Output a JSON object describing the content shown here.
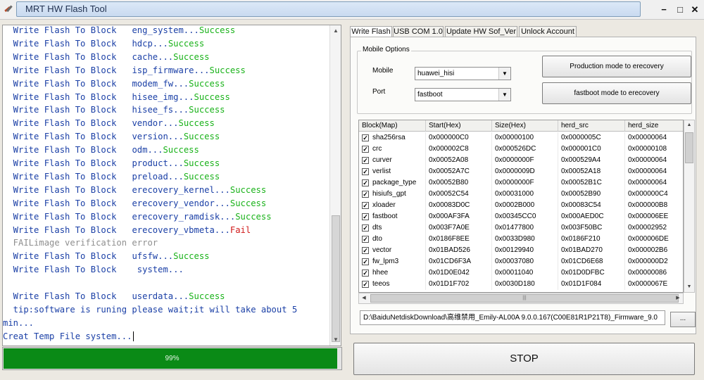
{
  "window": {
    "title": "MRT HW Flash Tool",
    "app_icon": "tool-icon",
    "controls": {
      "minimize": "−",
      "maximize": "□",
      "close": "✕"
    }
  },
  "log": {
    "lines": [
      {
        "parts": [
          {
            "text": "  Write Flash To Block   ",
            "color": "blue"
          },
          {
            "text": "eng_system...",
            "color": "blue"
          },
          {
            "text": "Success",
            "color": "green"
          }
        ]
      },
      {
        "parts": [
          {
            "text": "  Write Flash To Block   ",
            "color": "blue"
          },
          {
            "text": "hdcp...",
            "color": "blue"
          },
          {
            "text": "Success",
            "color": "green"
          }
        ]
      },
      {
        "parts": [
          {
            "text": "  Write Flash To Block   ",
            "color": "blue"
          },
          {
            "text": "cache...",
            "color": "blue"
          },
          {
            "text": "Success",
            "color": "green"
          }
        ]
      },
      {
        "parts": [
          {
            "text": "  Write Flash To Block   ",
            "color": "blue"
          },
          {
            "text": "isp_firmware...",
            "color": "blue"
          },
          {
            "text": "Success",
            "color": "green"
          }
        ]
      },
      {
        "parts": [
          {
            "text": "  Write Flash To Block   ",
            "color": "blue"
          },
          {
            "text": "modem_fw...",
            "color": "blue"
          },
          {
            "text": "Success",
            "color": "green"
          }
        ]
      },
      {
        "parts": [
          {
            "text": "  Write Flash To Block   ",
            "color": "blue"
          },
          {
            "text": "hisee_img...",
            "color": "blue"
          },
          {
            "text": "Success",
            "color": "green"
          }
        ]
      },
      {
        "parts": [
          {
            "text": "  Write Flash To Block   ",
            "color": "blue"
          },
          {
            "text": "hisee_fs...",
            "color": "blue"
          },
          {
            "text": "Success",
            "color": "green"
          }
        ]
      },
      {
        "parts": [
          {
            "text": "  Write Flash To Block   ",
            "color": "blue"
          },
          {
            "text": "vendor...",
            "color": "blue"
          },
          {
            "text": "Success",
            "color": "green"
          }
        ]
      },
      {
        "parts": [
          {
            "text": "  Write Flash To Block   ",
            "color": "blue"
          },
          {
            "text": "version...",
            "color": "blue"
          },
          {
            "text": "Success",
            "color": "green"
          }
        ]
      },
      {
        "parts": [
          {
            "text": "  Write Flash To Block   ",
            "color": "blue"
          },
          {
            "text": "odm...",
            "color": "blue"
          },
          {
            "text": "Success",
            "color": "green"
          }
        ]
      },
      {
        "parts": [
          {
            "text": "  Write Flash To Block   ",
            "color": "blue"
          },
          {
            "text": "product...",
            "color": "blue"
          },
          {
            "text": "Success",
            "color": "green"
          }
        ]
      },
      {
        "parts": [
          {
            "text": "  Write Flash To Block   ",
            "color": "blue"
          },
          {
            "text": "preload...",
            "color": "blue"
          },
          {
            "text": "Success",
            "color": "green"
          }
        ]
      },
      {
        "parts": [
          {
            "text": "  Write Flash To Block   ",
            "color": "blue"
          },
          {
            "text": "erecovery_kernel...",
            "color": "blue"
          },
          {
            "text": "Success",
            "color": "green"
          }
        ]
      },
      {
        "parts": [
          {
            "text": "  Write Flash To Block   ",
            "color": "blue"
          },
          {
            "text": "erecovery_vendor...",
            "color": "blue"
          },
          {
            "text": "Success",
            "color": "green"
          }
        ]
      },
      {
        "parts": [
          {
            "text": "  Write Flash To Block   ",
            "color": "blue"
          },
          {
            "text": "erecovery_ramdisk...",
            "color": "blue"
          },
          {
            "text": "Success",
            "color": "green"
          }
        ]
      },
      {
        "parts": [
          {
            "text": "  Write Flash To Block   ",
            "color": "blue"
          },
          {
            "text": "erecovery_vbmeta...",
            "color": "blue"
          },
          {
            "text": "Fail",
            "color": "red"
          }
        ]
      },
      {
        "parts": [
          {
            "text": "  FAILimage verification error",
            "color": "gray"
          }
        ]
      },
      {
        "parts": [
          {
            "text": "  Write Flash To Block   ",
            "color": "blue"
          },
          {
            "text": "ufsfw...",
            "color": "blue"
          },
          {
            "text": "Success",
            "color": "green"
          }
        ]
      },
      {
        "parts": [
          {
            "text": "  Write Flash To Block    ",
            "color": "blue"
          },
          {
            "text": "system...",
            "color": "blue"
          }
        ]
      },
      {
        "parts": [
          {
            "text": "",
            "color": "blue"
          }
        ]
      },
      {
        "parts": [
          {
            "text": "  Write Flash To Block   ",
            "color": "blue"
          },
          {
            "text": "userdata...",
            "color": "blue"
          },
          {
            "text": "Success",
            "color": "green"
          }
        ]
      },
      {
        "parts": [
          {
            "text": "  tip:software is runing please wait;it will take about 5",
            "color": "blue"
          }
        ]
      },
      {
        "parts": [
          {
            "text": "min...",
            "color": "blue"
          }
        ]
      },
      {
        "parts": [
          {
            "text": "Creat Temp File system...",
            "color": "blue"
          }
        ],
        "caret": true
      }
    ]
  },
  "progress": {
    "value": 0.99,
    "label": "99%",
    "fill_color": "#0a8a16"
  },
  "tabs": [
    {
      "label": "Write Flash",
      "active": true
    },
    {
      "label": "USB COM 1.0",
      "active": false
    },
    {
      "label": "Update HW Sof_Ver",
      "active": false
    },
    {
      "label": "Unlock Account",
      "active": false
    }
  ],
  "mobile_options": {
    "title": "Mobile Options",
    "mobile_label": "Mobile",
    "mobile_value": "huawei_hisi",
    "port_label": "Port",
    "port_value": "fastboot",
    "production_button": "Production mode to erecovery",
    "fastboot_button": "fastboot mode to erecovery"
  },
  "grid": {
    "columns": [
      "Block(Map)",
      "Start(Hex)",
      "Size(Hex)",
      "herd_src",
      "herd_size"
    ],
    "rows": [
      {
        "checked": true,
        "block": "sha256rsa",
        "start": "0x000000C0",
        "size": "0x00000100",
        "src": "0x0000005C",
        "hsize": "0x00000064"
      },
      {
        "checked": true,
        "block": "crc",
        "start": "0x000002C8",
        "size": "0x000526DC",
        "src": "0x000001C0",
        "hsize": "0x00000108"
      },
      {
        "checked": true,
        "block": "curver",
        "start": "0x00052A08",
        "size": "0x0000000F",
        "src": "0x000529A4",
        "hsize": "0x00000064"
      },
      {
        "checked": true,
        "block": "verlist",
        "start": "0x00052A7C",
        "size": "0x0000009D",
        "src": "0x00052A18",
        "hsize": "0x00000064"
      },
      {
        "checked": true,
        "block": "package_type",
        "start": "0x00052B80",
        "size": "0x0000000F",
        "src": "0x00052B1C",
        "hsize": "0x00000064"
      },
      {
        "checked": true,
        "block": "hisiufs_gpt",
        "start": "0x00052C54",
        "size": "0x00031000",
        "src": "0x00052B90",
        "hsize": "0x000000C4"
      },
      {
        "checked": true,
        "block": "xloader",
        "start": "0x00083D0C",
        "size": "0x0002B000",
        "src": "0x00083C54",
        "hsize": "0x000000B8"
      },
      {
        "checked": true,
        "block": "fastboot",
        "start": "0x000AF3FA",
        "size": "0x00345CC0",
        "src": "0x000AED0C",
        "hsize": "0x000006EE"
      },
      {
        "checked": true,
        "block": "dts",
        "start": "0x003F7A0E",
        "size": "0x01477800",
        "src": "0x003F50BC",
        "hsize": "0x00002952"
      },
      {
        "checked": true,
        "block": "dto",
        "start": "0x0186F8EE",
        "size": "0x0033D980",
        "src": "0x0186F210",
        "hsize": "0x000006DE"
      },
      {
        "checked": true,
        "block": "vector",
        "start": "0x01BAD526",
        "size": "0x00129940",
        "src": "0x01BAD270",
        "hsize": "0x000002B6"
      },
      {
        "checked": true,
        "block": "fw_lpm3",
        "start": "0x01CD6F3A",
        "size": "0x00037080",
        "src": "0x01CD6E68",
        "hsize": "0x000000D2"
      },
      {
        "checked": true,
        "block": "hhee",
        "start": "0x01D0E042",
        "size": "0x00011040",
        "src": "0x01D0DFBC",
        "hsize": "0x00000086"
      },
      {
        "checked": true,
        "block": "teeos",
        "start": "0x01D1F702",
        "size": "0x0030D180",
        "src": "0x01D1F084",
        "hsize": "0x0000067E"
      }
    ]
  },
  "file_path": "D:\\BaiduNetdiskDownload\\高维禁用_Emily-AL00A 9.0.0.167(C00E81R1P21T8)_Firmware_9.0",
  "browse_label": "...",
  "stop_label": "STOP"
}
